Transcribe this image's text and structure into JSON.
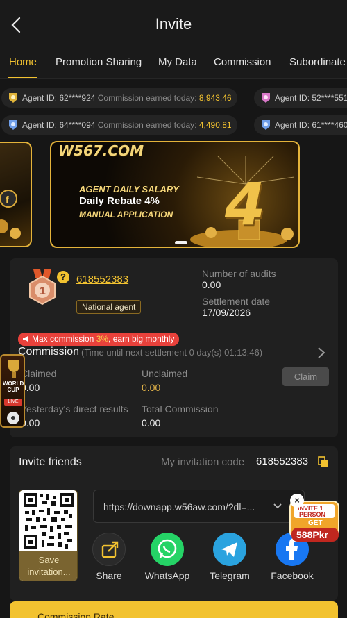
{
  "header": {
    "title": "Invite"
  },
  "tabs": [
    "Home",
    "Promotion Sharing",
    "My Data",
    "Commission",
    "Subordinate"
  ],
  "ticker": {
    "row1": [
      {
        "agent_id": "Agent ID: 62****924",
        "text": "Commission earned today:",
        "amount": "8,943.46"
      },
      {
        "agent_id": "Agent ID: 52****551",
        "text": "",
        "amount": ""
      }
    ],
    "row2": [
      {
        "agent_id": "Agent ID: 64****094",
        "text": "Commission earned today:",
        "amount": "4,490.81"
      },
      {
        "agent_id": "Agent ID: 61****460",
        "text": "",
        "amount": ""
      }
    ]
  },
  "banner": {
    "logo": "W567.COM",
    "line1": "AGENT DAILY SALARY",
    "line2": "Daily Rebate 4%",
    "line3": "MANUAL APPLICATION",
    "big": "4"
  },
  "agent": {
    "level": "1",
    "code": "618552383",
    "badge": "National agent",
    "audits_label": "Number of audits",
    "audits_value": "0.00",
    "settlement_label": "Settlement date",
    "settlement_value": "17/09/2026"
  },
  "commission": {
    "promo_prefix": "Max commission ",
    "promo_pct": "3%",
    "promo_suffix": ", earn big monthly",
    "title": "Commission",
    "note": "(Time until next settlement  0 day(s) 01:13:46)",
    "claimed_label": "Claimed",
    "claimed_value": "0.00",
    "unclaimed_label": "Unclaimed",
    "unclaimed_value": "0.00",
    "claim_button": "Claim",
    "yesterday_label": "Yesterday's direct results",
    "yesterday_value": "0.00",
    "total_label": "Total Commission",
    "total_value": "0.00"
  },
  "world_cup": {
    "line1": "WORLD",
    "line2": "CUP",
    "live": "LIVE"
  },
  "invite": {
    "title": "Invite friends",
    "code_label": "My invitation code",
    "code_value": "618552383",
    "save_label": "Save invitation...",
    "url": "https://downapp.w56aw.com/?dl=..."
  },
  "share": [
    {
      "label": "Share",
      "color": "#2a2a2a"
    },
    {
      "label": "WhatsApp",
      "color": "#25d366"
    },
    {
      "label": "Telegram",
      "color": "#2aa3df"
    },
    {
      "label": "Facebook",
      "color": "#1877f2"
    }
  ],
  "float_invite": {
    "line1": "INVITE 1",
    "line2": "PERSON",
    "line3": "GET",
    "amount": "588Pkr"
  },
  "bottom": {
    "label": "Commission Rate"
  },
  "colors": {
    "accent": "#f2c230",
    "background": "#161616",
    "card": "#202020"
  }
}
